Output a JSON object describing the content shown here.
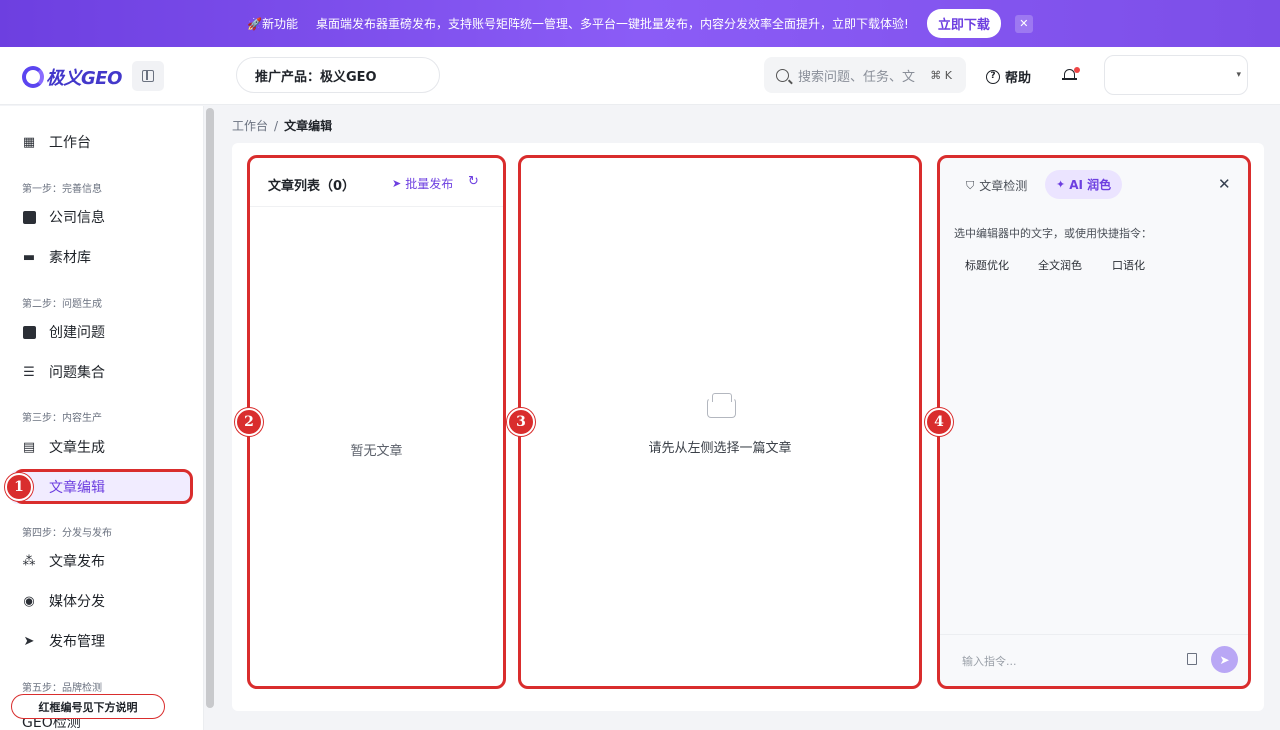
{
  "banner": {
    "tag": "🚀新功能",
    "message": "桌面端发布器重磅发布，支持账号矩阵统一管理、多平台一键批量发布，内容分发效率全面提升，立即下载体验!",
    "download_label": "立即下载",
    "close_label": "✕"
  },
  "header": {
    "logo_text": "极义GEO",
    "product": "推广产品：极义GEO",
    "search_placeholder": "搜索问题、任务、文",
    "search_shortcut": "⌘ K",
    "help_label": "帮助"
  },
  "sidebar": {
    "items": [
      {
        "label": "工作台",
        "icon": "grid-icon"
      },
      {
        "step": "第一步：完善信息"
      },
      {
        "label": "公司信息",
        "icon": "image-icon"
      },
      {
        "label": "素材库",
        "icon": "folder-icon"
      },
      {
        "step": "第二步：问题生成"
      },
      {
        "label": "创建问题",
        "icon": "edit-icon"
      },
      {
        "label": "问题集合",
        "icon": "stack-icon"
      },
      {
        "step": "第三步：内容生产"
      },
      {
        "label": "文章生成",
        "icon": "document-icon"
      },
      {
        "label": "文章编辑",
        "icon": "pen-icon",
        "active": true
      },
      {
        "step": "第四步：分发与发布"
      },
      {
        "label": "文章发布",
        "icon": "share-icon"
      },
      {
        "label": "媒体分发",
        "icon": "broadcast-icon"
      },
      {
        "label": "发布管理",
        "icon": "send-icon"
      },
      {
        "step": "第五步：品牌检测"
      },
      {
        "label": "GEO检测",
        "icon": "check-icon"
      }
    ]
  },
  "breadcrumb": {
    "root": "工作台",
    "sep": "/",
    "current": "文章编辑"
  },
  "article_list": {
    "title": "文章列表（0）",
    "batch_publish": "批量发布",
    "empty": "暂无文章"
  },
  "editor": {
    "empty": "请先从左侧选择一篇文章"
  },
  "ai_panel": {
    "tab_detect": "文章检测",
    "tab_polish": "AI 润色",
    "hint": "选中编辑器中的文字，或使用快捷指令：",
    "quick_actions": [
      "标题优化",
      "全文润色",
      "口语化"
    ],
    "input_placeholder": "输入指令..."
  },
  "annotations": {
    "badges": [
      "1",
      "2",
      "3",
      "4"
    ],
    "note": "红框编号见下方说明"
  },
  "colors": {
    "accent": "#6d3fe0",
    "annotation_red": "#d92d2d"
  }
}
